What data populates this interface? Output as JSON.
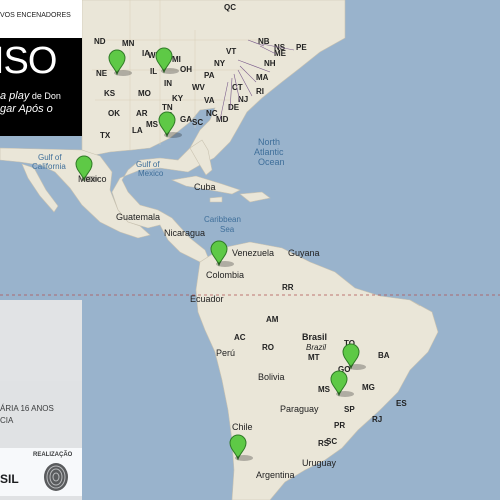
{
  "panel": {
    "top_title": "VOS ENCENADORES",
    "logo_word": "ISO",
    "credit_line1_italic": "a play",
    "credit_line1_rest": " de Don",
    "credit_line2": "gar Após o",
    "age_rating": "ÁRIA 16 ANOS",
    "age_line2": "CIA",
    "realizacao": "REALIZAÇÃO",
    "sponsor_text": "SIL"
  },
  "map": {
    "oceans": [
      {
        "name": "North Atlantic Ocean",
        "lines": [
          "North",
          "Atlantic",
          "Ocean"
        ]
      },
      {
        "name": "Gulf of Mexico",
        "lines": [
          "Gulf of",
          "Mexico"
        ]
      },
      {
        "name": "Gulf of California",
        "lines": [
          "Gulf of",
          "California"
        ]
      },
      {
        "name": "Caribbean Sea",
        "lines": [
          "Caribbean",
          "Sea"
        ]
      }
    ],
    "countries": [
      "Mexico",
      "Cuba",
      "Guatemala",
      "Nicaragua",
      "Venezuela",
      "Guyana",
      "Colombia",
      "Ecuador",
      "Brasil",
      "Brazil",
      "Peru",
      "Bolivia",
      "Paraguay",
      "Chile",
      "Argentina",
      "Uruguay"
    ],
    "us_states": [
      "ND",
      "MN",
      "NE",
      "IA",
      "KS",
      "MO",
      "OK",
      "AR",
      "TX",
      "LA",
      "MS",
      "AL",
      "GA",
      "TN",
      "IL",
      "IN",
      "OH",
      "KY",
      "WV",
      "VA",
      "NC",
      "SC",
      "PA",
      "NY",
      "VT",
      "NH",
      "ME",
      "MA",
      "CT",
      "RI",
      "NJ",
      "DE",
      "MD",
      "WI",
      "MI"
    ],
    "br_states": [
      "RR",
      "AM",
      "AC",
      "RO",
      "MT",
      "TO",
      "BA",
      "GO",
      "MG",
      "MS",
      "SP",
      "ES",
      "RJ",
      "PR",
      "SC",
      "RS"
    ],
    "top_labels": [
      "QC",
      "NB",
      "PE",
      "NS"
    ],
    "markers": [
      {
        "name": "Nebraska",
        "icon": "green-map-marker"
      },
      {
        "name": "Wisconsin",
        "icon": "green-map-marker"
      },
      {
        "name": "Louisiana",
        "icon": "green-map-marker"
      },
      {
        "name": "Mexico",
        "icon": "green-map-marker"
      },
      {
        "name": "Colombia",
        "icon": "green-map-marker"
      },
      {
        "name": "Goiás",
        "icon": "green-map-marker"
      },
      {
        "name": "São Paulo",
        "icon": "green-map-marker"
      },
      {
        "name": "Chile",
        "icon": "green-map-marker"
      }
    ],
    "colors": {
      "ocean": "#99b3cc",
      "land": "#eae6d8",
      "marker": "#5ec946"
    }
  }
}
